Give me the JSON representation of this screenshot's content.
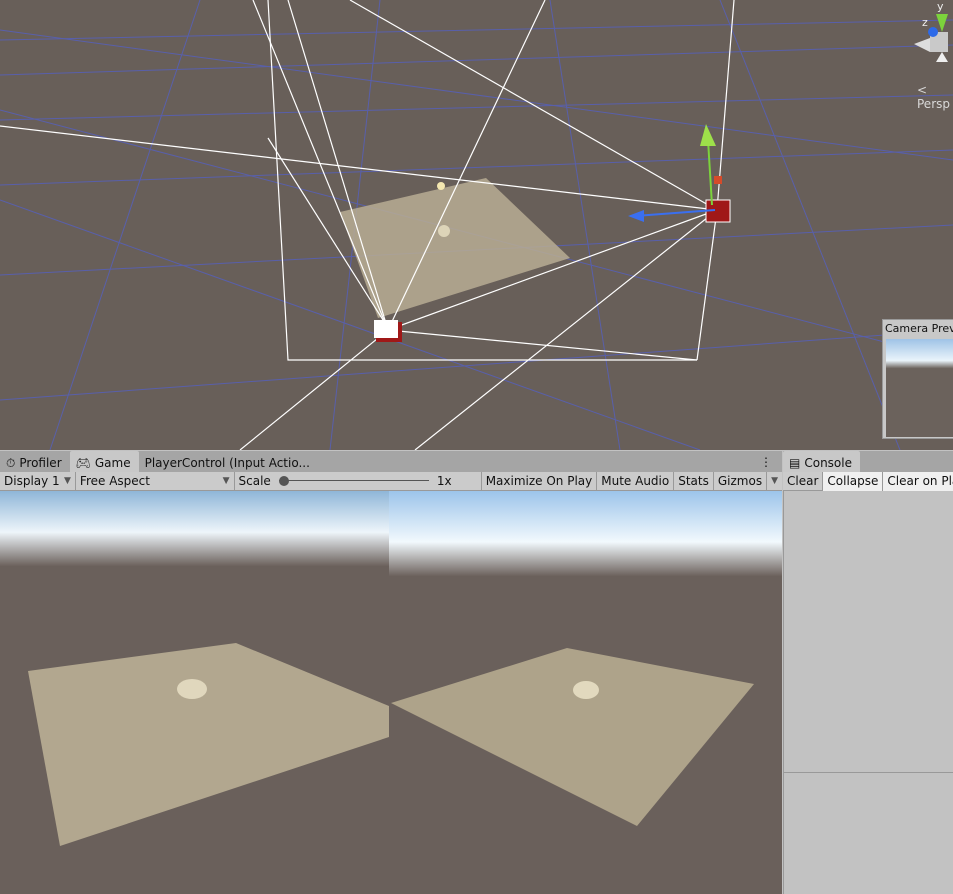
{
  "scene": {
    "gizmo_axis_y": "y",
    "gizmo_axis_z": "z",
    "projection_label": "< Persp",
    "camera_preview_title": "Camera Preview",
    "colors": {
      "background": "#685f59",
      "grid": "#4f5cc8",
      "ground": "#b8ad94"
    }
  },
  "game_panel": {
    "tabs": [
      {
        "label": "Profiler",
        "icon": "stopwatch-icon"
      },
      {
        "label": "Game",
        "icon": "gamepad-icon",
        "active": true
      },
      {
        "label": "PlayerControl (Input Actio...",
        "icon": ""
      }
    ],
    "display_select": "Display 1",
    "aspect_select": "Free Aspect",
    "scale_label": "Scale",
    "scale_value": "1x",
    "scale_slider_fraction": 0,
    "buttons": [
      "Maximize On Play",
      "Mute Audio",
      "Stats",
      "Gizmos"
    ]
  },
  "console_panel": {
    "tab_label": "Console",
    "buttons": [
      "Clear",
      "Collapse",
      "Clear on Play"
    ]
  }
}
